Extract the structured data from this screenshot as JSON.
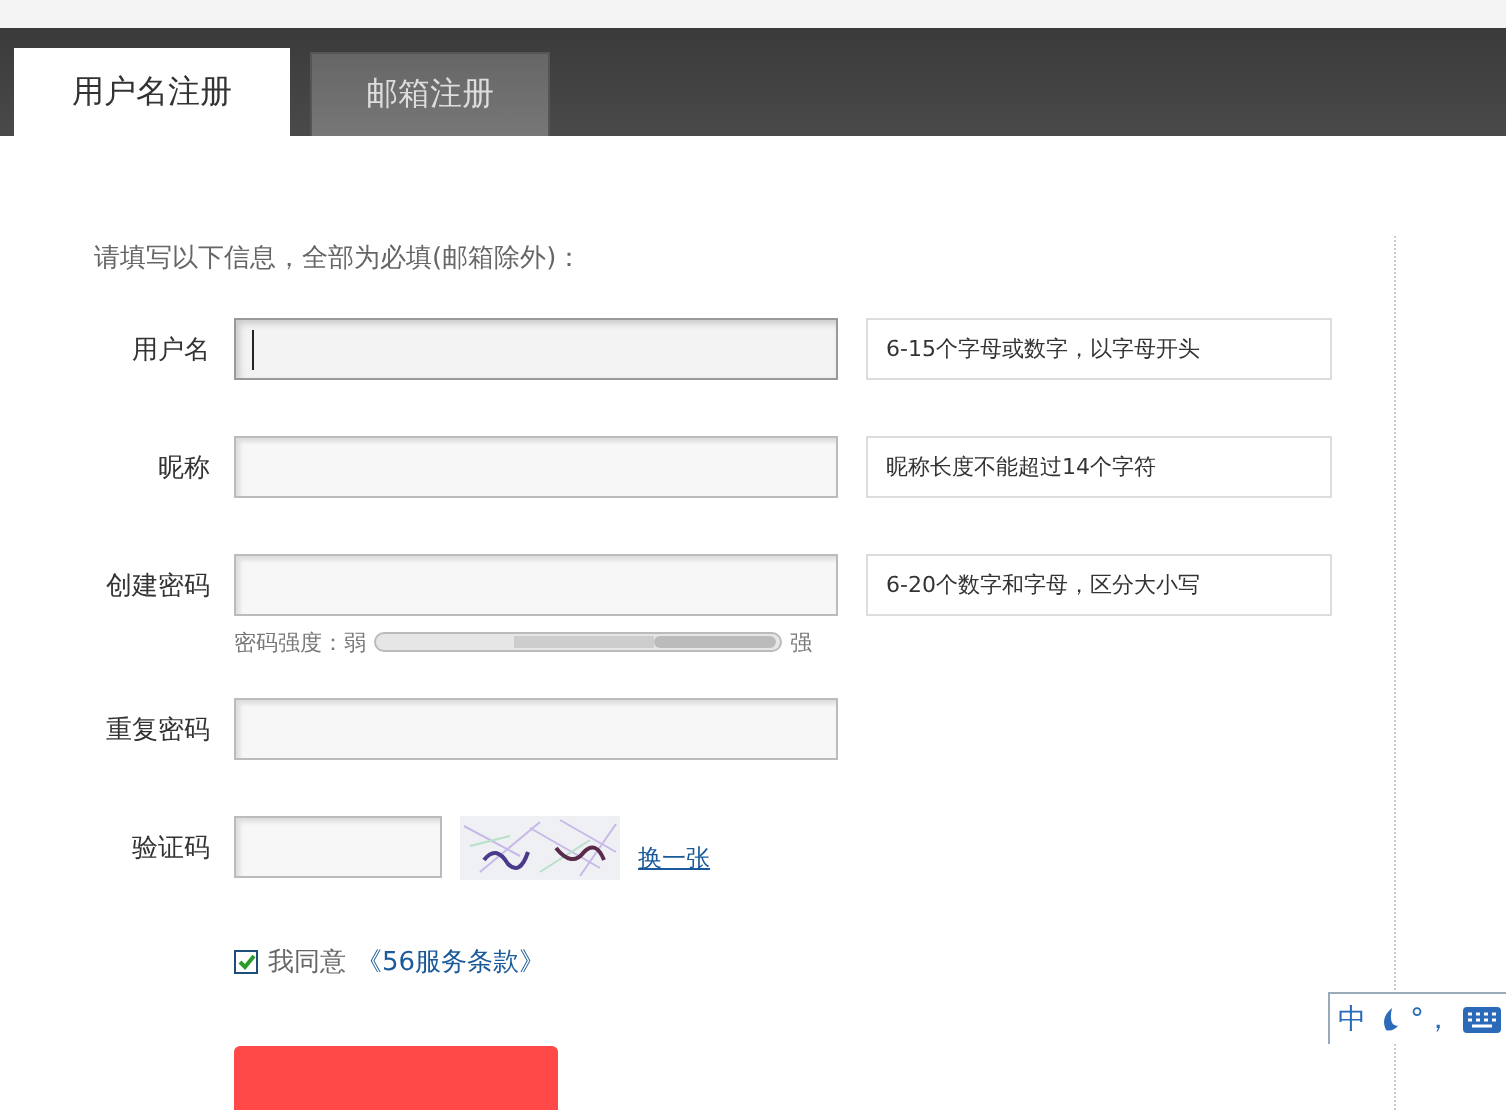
{
  "tabs": [
    {
      "label": "用户名注册",
      "selected": true
    },
    {
      "label": "邮箱注册",
      "selected": false
    }
  ],
  "intro": "请填写以下信息，全部为必填(邮箱除外)：",
  "fields": [
    {
      "label": "用户名",
      "hint": "6-15个字母或数字，以字母开头",
      "focused": true
    },
    {
      "label": "昵称",
      "hint": "昵称长度不能超过14个字符",
      "focused": false
    },
    {
      "label": "创建密码",
      "hint": "6-20个数字和字母，区分大小写",
      "focused": false,
      "strength": {
        "label": "密码强度：弱",
        "end_label": "强"
      }
    },
    {
      "label": "重复密码",
      "focused": false
    }
  ],
  "captcha": {
    "label": "验证码",
    "refresh_link": "换一张"
  },
  "agree": {
    "checked": true,
    "text": "我同意",
    "link": "《56服务条款》"
  },
  "submit": {
    "kind": "button"
  },
  "ime_bar": {
    "mode": "中",
    "punctuation": "°，"
  }
}
